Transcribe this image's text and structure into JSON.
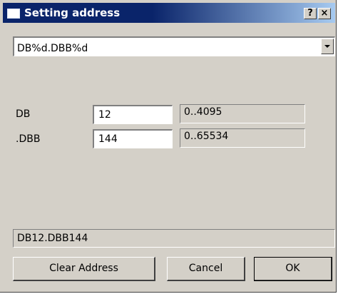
{
  "window": {
    "title": "Setting address",
    "help_label": "?",
    "close_label": "×"
  },
  "format_select": {
    "selected": "DB%d.DBB%d"
  },
  "fields": [
    {
      "label": "DB",
      "value": "12",
      "range": "0..4095"
    },
    {
      "label": ".DBB",
      "value": "144",
      "range": "0..65534"
    }
  ],
  "result": {
    "address": "DB12.DBB144"
  },
  "buttons": {
    "clear": "Clear Address",
    "cancel": "Cancel",
    "ok": "OK"
  },
  "colors": {
    "title_start": "#0a246a",
    "title_end": "#a6caf0",
    "face": "#d4d0c8"
  }
}
